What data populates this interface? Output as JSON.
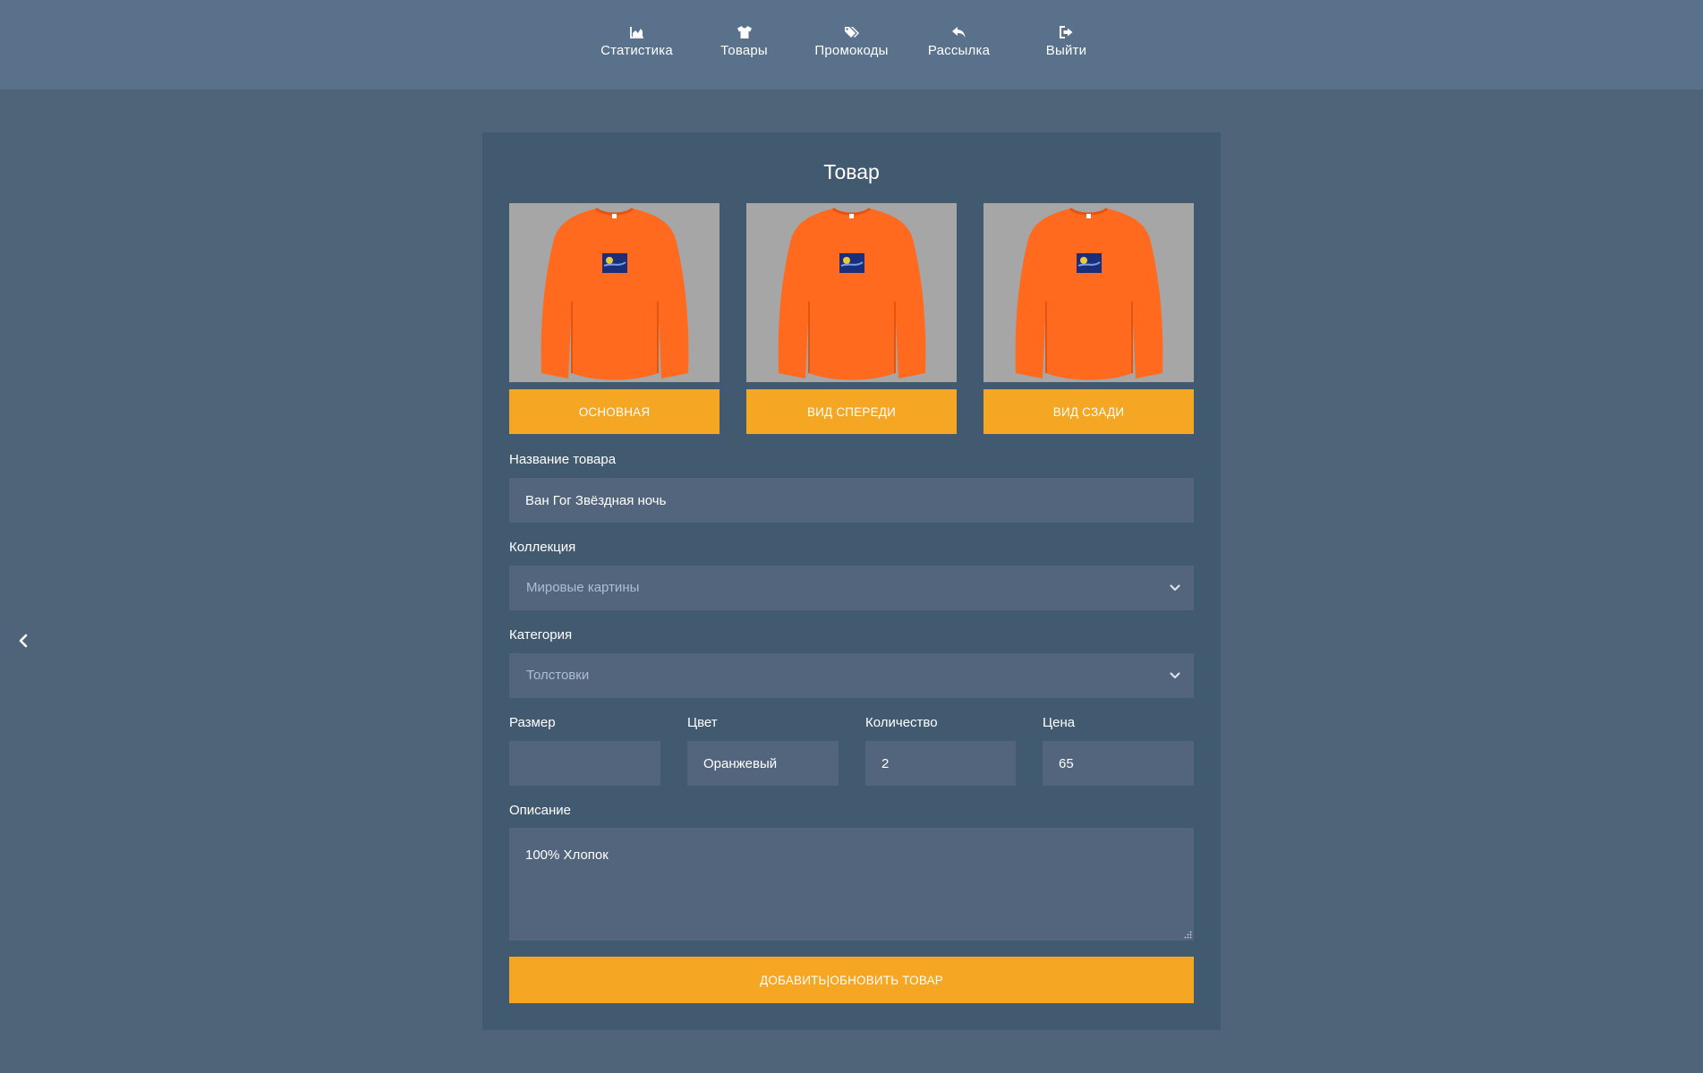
{
  "nav": {
    "items": [
      {
        "label": "Статистика",
        "icon": "area-chart-icon"
      },
      {
        "label": "Товары",
        "icon": "tshirt-icon"
      },
      {
        "label": "Промокоды",
        "icon": "tags-icon"
      },
      {
        "label": "Рассылка",
        "icon": "reply-icon"
      },
      {
        "label": "Выйти",
        "icon": "sign-out-icon"
      }
    ]
  },
  "sidebar": {
    "back_icon": "chevron-left-icon"
  },
  "form": {
    "title": "Товар",
    "photos": [
      {
        "button_label": "Основная"
      },
      {
        "button_label": "Вид спереди"
      },
      {
        "button_label": "Вид сзади"
      }
    ],
    "name": {
      "label": "Название товара",
      "value": "Ван Гог Звёздная ночь"
    },
    "collection": {
      "label": "Коллекция",
      "value": "Мировые картины"
    },
    "category": {
      "label": "Категория",
      "value": "Толстовки"
    },
    "size": {
      "label": "Размер",
      "value": ""
    },
    "color": {
      "label": "Цвет",
      "value": "Оранжевый"
    },
    "quantity": {
      "label": "Количество",
      "value": "2"
    },
    "price": {
      "label": "Цена",
      "value": "65"
    },
    "description": {
      "label": "Описание",
      "value": "100% Хлопок"
    },
    "submit_label": "Добавить|обновить товар"
  },
  "colors": {
    "page_bg": "#4f6479",
    "header_bg": "#59718a",
    "card_bg": "#425a70",
    "input_bg": "#53657d",
    "accent": "#f5a623",
    "product_color": "#ff6a1f"
  }
}
